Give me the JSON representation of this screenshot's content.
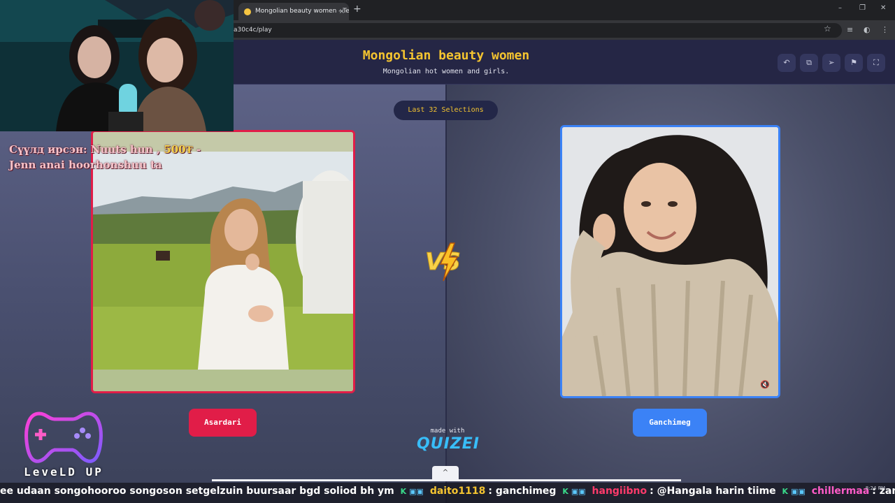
{
  "browser": {
    "tab_title": "Mongolian beauty women - Te",
    "tab_close": "×",
    "new_tab": "+",
    "url": "a30c4c/play",
    "window_controls": [
      "–",
      "❐",
      "✕"
    ]
  },
  "header": {
    "title": "Mongolian beauty women",
    "subtitle": "Mongolian hot women and girls."
  },
  "stage": {
    "selections_pill": "Last 32 Selections",
    "vs_label": "VS",
    "left_choice": "Asardari",
    "right_choice": "Ganchimeg",
    "made_with": "made with",
    "brand": "QUIZEI",
    "scroll_up": "^"
  },
  "overlay": {
    "donation_line1_prefix": "Сүүлд ирсэн: Nuuts hun , ",
    "donation_amount": "500₮",
    "donation_line1_suffix": " -",
    "donation_line2": "Jenn anai hoorhonshuu ta",
    "brand_text": "LeveLD UP"
  },
  "ticker": {
    "lead_text": "ee udaan songohooroo songoson setgelzuin buursaar bgd soliod bh ym",
    "messages": [
      {
        "user": "daito1118",
        "text": ": ganchimeg"
      },
      {
        "user": "hangiibno",
        "text": ": @Hangala harin tiime"
      },
      {
        "user": "chillermaa",
        "text": ": zamilan chine bvvr vnheer g"
      }
    ]
  },
  "taskbar": {
    "time": "8:24 PM"
  },
  "colors": {
    "accent_yellow": "#f4c430",
    "left_red": "#e11d48",
    "right_blue": "#3b82f6",
    "header_bg": "#252645"
  },
  "icons": [
    "undo-icon",
    "share-icon",
    "send-icon",
    "flag-icon",
    "fullscreen-icon",
    "mute-icon",
    "star-icon"
  ]
}
